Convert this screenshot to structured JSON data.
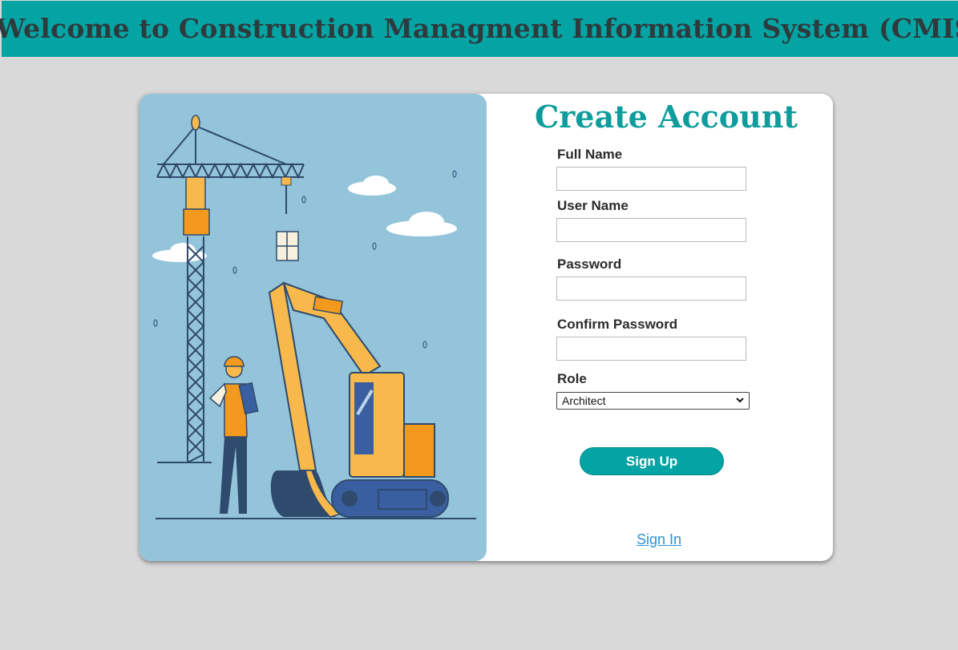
{
  "header": {
    "title": "Welcome to Construction Managment Information System (CMIS)"
  },
  "form": {
    "title": "Create Account",
    "full_name": {
      "label": "Full Name",
      "value": ""
    },
    "user_name": {
      "label": "User Name",
      "value": ""
    },
    "password": {
      "label": "Password",
      "value": ""
    },
    "confirm_password": {
      "label": "Confirm Password",
      "value": ""
    },
    "role": {
      "label": "Role",
      "selected": "Architect"
    },
    "submit_label": "Sign Up",
    "signin_link": "Sign In"
  },
  "colors": {
    "accent": "#05a4a4",
    "background": "#d9d9d9",
    "illustration_bg": "#94c4d9",
    "link": "#2a92d6"
  },
  "icons": {
    "role_dropdown": "chevron-down-icon"
  }
}
